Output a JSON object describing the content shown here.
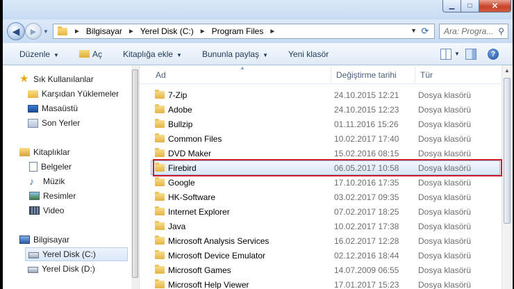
{
  "window": {
    "minimize": "▁",
    "maximize": "□",
    "close": "✕"
  },
  "nav": {
    "back": "◀",
    "forward": "▶",
    "dropdown": "▼"
  },
  "address": {
    "crumbs": [
      "Bilgisayar",
      "Yerel Disk (C:)",
      "Program Files"
    ],
    "separator": "►",
    "dropdown": "▼",
    "refresh": "⟳"
  },
  "search": {
    "placeholder": "Ara: Program Files",
    "display": "Ara: Progra...",
    "icon": "⚲"
  },
  "toolbar": {
    "organize": "Düzenle",
    "open": "Aç",
    "add_to_library": "Kitaplığa ekle",
    "share_with": "Bununla paylaş",
    "new_folder": "Yeni klasör",
    "arrow": "▼",
    "help": "?"
  },
  "sidebar": {
    "favorites": {
      "label": "Sık Kullanılanlar",
      "items": [
        "Karşıdan Yüklemeler",
        "Masaüstü",
        "Son Yerler"
      ]
    },
    "libraries": {
      "label": "Kitaplıklar",
      "items": [
        "Belgeler",
        "Müzik",
        "Resimler",
        "Video"
      ]
    },
    "computer": {
      "label": "Bilgisayar",
      "items": [
        "Yerel Disk (C:)",
        "Yerel Disk (D:)"
      ]
    }
  },
  "columns": {
    "name": "Ad",
    "date": "Değiştirme tarihi",
    "type": "Tür",
    "sort_indicator": "▲"
  },
  "files": [
    {
      "name": "7-Zip",
      "date": "24.10.2015 12:21",
      "type": "Dosya klasörü"
    },
    {
      "name": "Adobe",
      "date": "24.10.2015 12:23",
      "type": "Dosya klasörü"
    },
    {
      "name": "Bullzip",
      "date": "01.11.2016 15:26",
      "type": "Dosya klasörü"
    },
    {
      "name": "Common Files",
      "date": "10.02.2017 17:40",
      "type": "Dosya klasörü"
    },
    {
      "name": "DVD Maker",
      "date": "15.02.2016 08:15",
      "type": "Dosya klasörü"
    },
    {
      "name": "Firebird",
      "date": "06.05.2017 10:58",
      "type": "Dosya klasörü"
    },
    {
      "name": "Google",
      "date": "17.10.2016 17:35",
      "type": "Dosya klasörü"
    },
    {
      "name": "HK-Software",
      "date": "03.02.2017 09:35",
      "type": "Dosya klasörü"
    },
    {
      "name": "Internet Explorer",
      "date": "07.02.2017 18:25",
      "type": "Dosya klasörü"
    },
    {
      "name": "Java",
      "date": "10.02.2017 17:38",
      "type": "Dosya klasörü"
    },
    {
      "name": "Microsoft Analysis Services",
      "date": "16.02.2017 12:28",
      "type": "Dosya klasörü"
    },
    {
      "name": "Microsoft Device Emulator",
      "date": "02.12.2016 18:44",
      "type": "Dosya klasörü"
    },
    {
      "name": "Microsoft Games",
      "date": "14.07.2009 06:55",
      "type": "Dosya klasörü"
    },
    {
      "name": "Microsoft Help Viewer",
      "date": "17.01.2017 15:23",
      "type": "Dosya klasörü"
    }
  ],
  "selected_file": "Firebird",
  "colors": {
    "highlight_border": "#d11a2a",
    "selection_bg": "#d9e7f8"
  }
}
